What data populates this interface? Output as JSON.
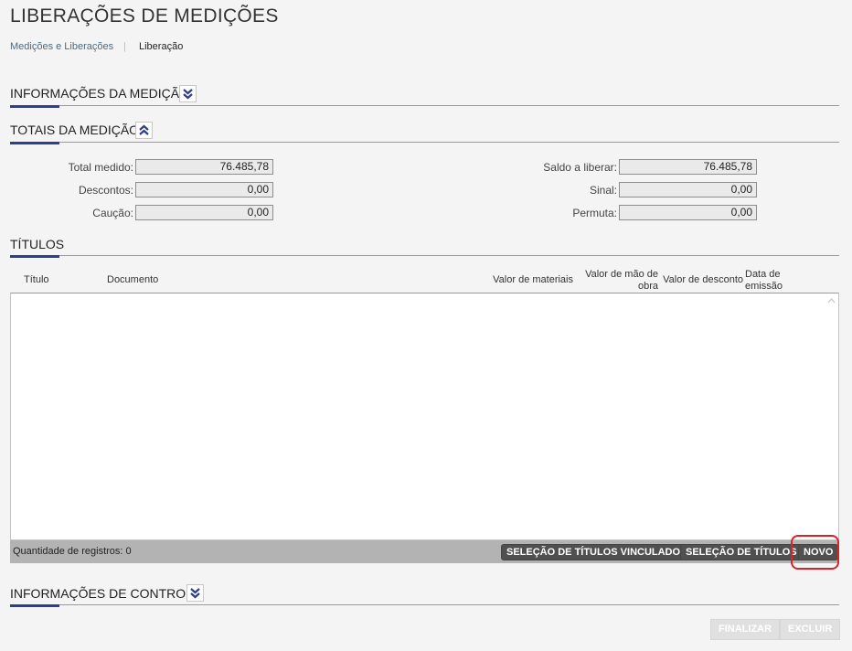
{
  "page": {
    "title": "LIBERAÇÕES DE MEDIÇÕES",
    "breadcrumb": [
      "Medições e Liberações",
      "Liberação"
    ]
  },
  "sections": {
    "info_medicao": "INFORMAÇÕES DA MEDIÇÃO",
    "totais": "TOTAIS DA MEDIÇÃO",
    "titulos": "TÍTULOS",
    "info_controle": "INFORMAÇÕES DE CONTROLE"
  },
  "totais": {
    "total_medido": {
      "label": "Total medido:",
      "value": "76.485,78"
    },
    "descontos": {
      "label": "Descontos:",
      "value": "0,00"
    },
    "caucao": {
      "label": "Caução:",
      "value": "0,00"
    },
    "saldo_a_liberar": {
      "label": "Saldo a liberar:",
      "value": "76.485,78"
    },
    "sinal": {
      "label": "Sinal:",
      "value": "0,00"
    },
    "permuta": {
      "label": "Permuta:",
      "value": "0,00"
    }
  },
  "grid": {
    "columns": {
      "titulo": "Título",
      "documento": "Documento",
      "valor_materiais": "Valor de materiais",
      "valor_mao_obra_1": "Valor de mão de",
      "valor_mao_obra_2": "obra",
      "valor_desconto": "Valor de desconto",
      "data_emissao_1": "Data de",
      "data_emissao_2": "emissão"
    },
    "rows": [],
    "record_count": "Quantidade de registros: 0",
    "buttons": {
      "selecao_vinculados": "SELEÇÃO DE TÍTULOS VINCULADOS",
      "selecao_titulos": "SELEÇÃO DE TÍTULOS",
      "novo": "NOVO"
    }
  },
  "actions": {
    "finalizar": "FINALIZAR",
    "excluir": "EXCLUIR"
  },
  "colors": {
    "accent": "#2c3e8c",
    "highlight": "#d9232b"
  }
}
